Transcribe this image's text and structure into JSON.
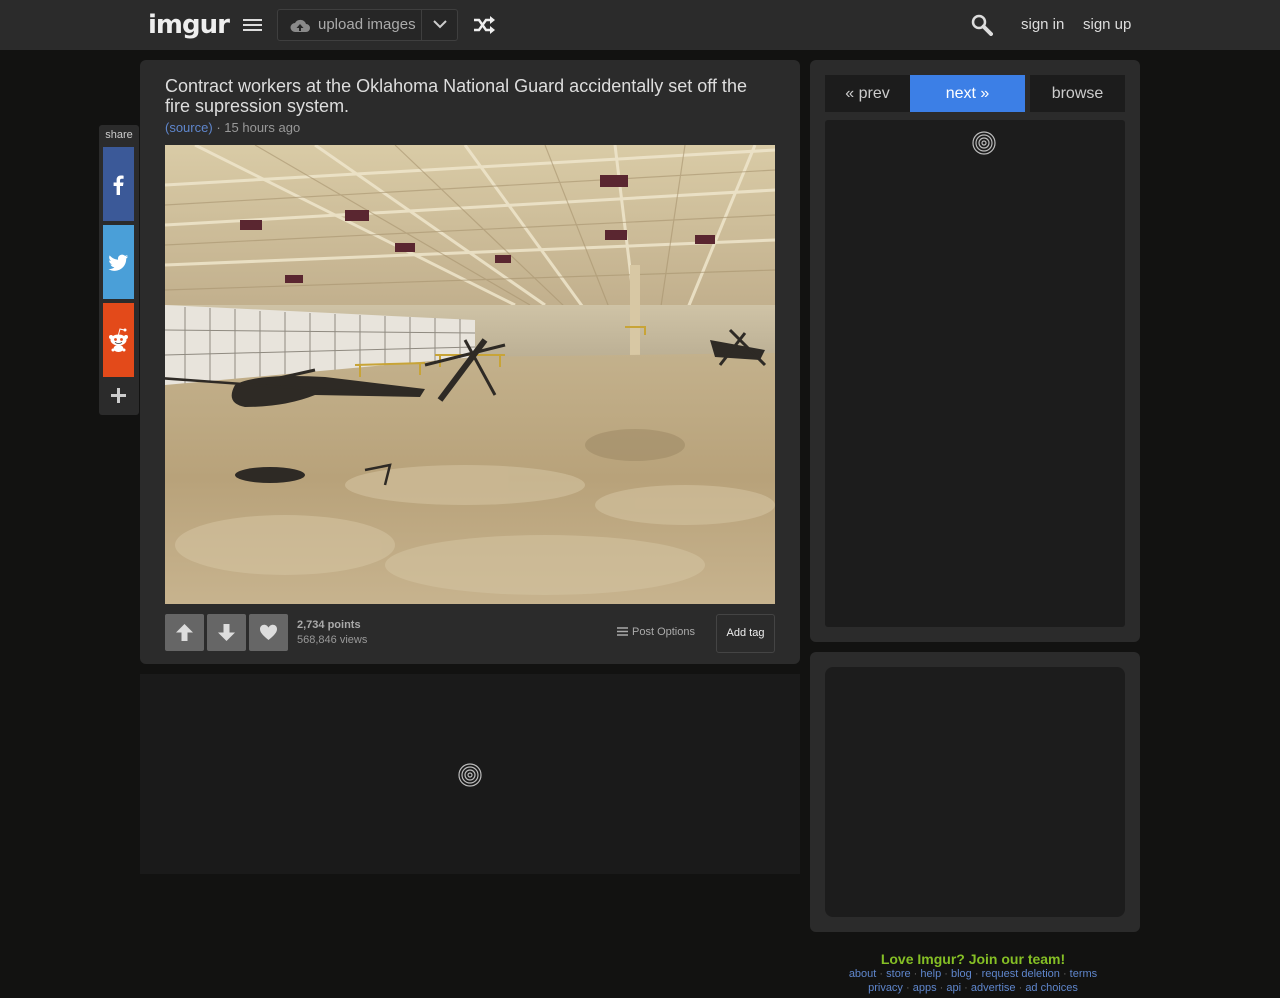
{
  "header": {
    "logo": "imgur",
    "upload_label": "upload images",
    "sign_in": "sign in",
    "sign_up": "sign up"
  },
  "share": {
    "label": "share"
  },
  "post": {
    "title": "Contract workers at the Oklahoma National Guard accidentally set off the fire supression system.",
    "source": "(source)",
    "separator": "·",
    "time": "15 hours ago",
    "points": "2,734 points",
    "views": "568,846 views",
    "post_options": "Post Options",
    "add_tag": "Add tag"
  },
  "navigation": {
    "prev": "« prev",
    "next": "next »",
    "browse": "browse"
  },
  "footer": {
    "join": "Love Imgur? Join our team!",
    "row1": [
      "about",
      "store",
      "help",
      "blog",
      "request deletion",
      "terms"
    ],
    "row2": [
      "privacy",
      "apps",
      "api",
      "advertise",
      "ad choices"
    ]
  },
  "colors": {
    "accent": "#3c7fe6",
    "link": "#5f86cc",
    "join": "#85bf25",
    "facebook": "#3b5998",
    "twitter": "#4a9fd8",
    "reddit": "#e34a1a"
  }
}
